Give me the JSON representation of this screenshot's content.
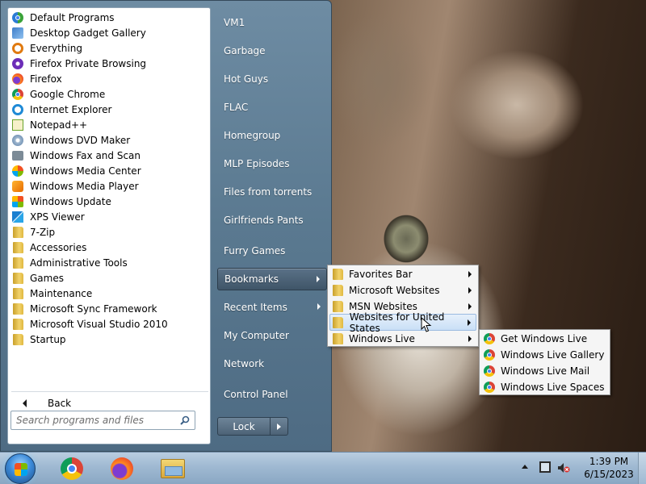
{
  "programs": [
    {
      "label": "Default Programs",
      "icon": "default-programs-icon"
    },
    {
      "label": "Desktop Gadget Gallery",
      "icon": "gadget-gallery-icon"
    },
    {
      "label": "Everything",
      "icon": "everything-search-icon"
    },
    {
      "label": "Firefox Private Browsing",
      "icon": "firefox-private-icon"
    },
    {
      "label": "Firefox",
      "icon": "firefox-icon"
    },
    {
      "label": "Google Chrome",
      "icon": "chrome-icon"
    },
    {
      "label": "Internet Explorer",
      "icon": "internet-explorer-icon"
    },
    {
      "label": "Notepad++",
      "icon": "notepad-plus-plus-icon"
    },
    {
      "label": "Windows DVD Maker",
      "icon": "dvd-maker-icon"
    },
    {
      "label": "Windows Fax and Scan",
      "icon": "fax-scan-icon"
    },
    {
      "label": "Windows Media Center",
      "icon": "media-center-icon"
    },
    {
      "label": "Windows Media Player",
      "icon": "media-player-icon"
    },
    {
      "label": "Windows Update",
      "icon": "windows-update-icon"
    },
    {
      "label": "XPS Viewer",
      "icon": "xps-viewer-icon"
    },
    {
      "label": "7-Zip",
      "icon": "folder-icon"
    },
    {
      "label": "Accessories",
      "icon": "folder-icon"
    },
    {
      "label": "Administrative Tools",
      "icon": "folder-icon"
    },
    {
      "label": "Games",
      "icon": "folder-icon"
    },
    {
      "label": "Maintenance",
      "icon": "folder-icon"
    },
    {
      "label": "Microsoft Sync Framework",
      "icon": "folder-icon"
    },
    {
      "label": "Microsoft Visual Studio 2010",
      "icon": "folder-icon"
    },
    {
      "label": "Startup",
      "icon": "folder-icon"
    }
  ],
  "back_label": "Back",
  "search": {
    "placeholder": "Search programs and files"
  },
  "right_items": [
    {
      "label": "VM1"
    },
    {
      "label": "Garbage"
    },
    {
      "label": "Hot Guys"
    },
    {
      "label": "FLAC"
    },
    {
      "label": "Homegroup"
    },
    {
      "label": "MLP Episodes"
    },
    {
      "label": "Files from torrents"
    },
    {
      "label": "Girlfriends Pants"
    },
    {
      "label": "Furry Games"
    },
    {
      "label": "Bookmarks"
    },
    {
      "label": "Recent Items"
    },
    {
      "label": "My Computer"
    },
    {
      "label": "Network"
    },
    {
      "label": "Control Panel"
    }
  ],
  "lock_label": "Lock",
  "bookmarks_menu": [
    {
      "label": "Favorites Bar"
    },
    {
      "label": "Microsoft Websites"
    },
    {
      "label": "MSN Websites"
    },
    {
      "label": "Websites for United States"
    },
    {
      "label": "Windows Live"
    }
  ],
  "windows_live_menu": [
    {
      "label": "Get Windows Live"
    },
    {
      "label": "Windows Live Gallery"
    },
    {
      "label": "Windows Live Mail"
    },
    {
      "label": "Windows Live Spaces"
    }
  ],
  "clock": {
    "time": "1:39 PM",
    "date": "6/15/2023"
  },
  "taskbar_apps": [
    "chrome-icon",
    "firefox-icon",
    "file-explorer-icon"
  ]
}
